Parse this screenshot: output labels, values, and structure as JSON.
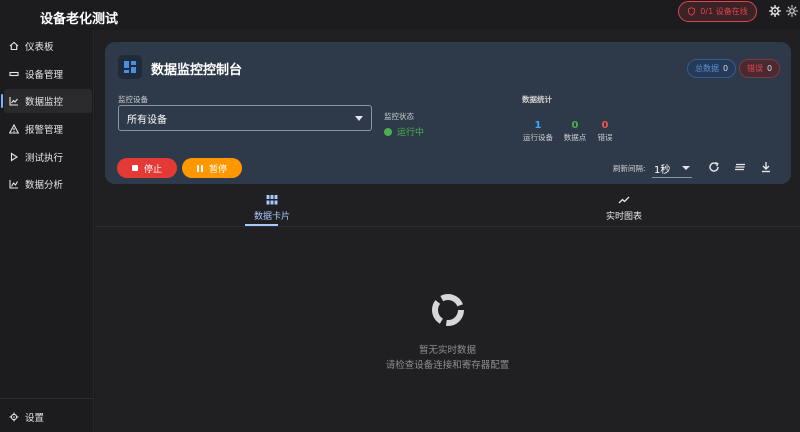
{
  "app": {
    "title": "设备老化测试"
  },
  "header": {
    "online_badge": "0/1 设备在线"
  },
  "sidebar": {
    "items": [
      {
        "label": "仪表板",
        "icon": "home-icon"
      },
      {
        "label": "设备管理",
        "icon": "device-icon"
      },
      {
        "label": "数据监控",
        "icon": "chart-icon"
      },
      {
        "label": "报警管理",
        "icon": "warning-icon"
      },
      {
        "label": "测试执行",
        "icon": "play-icon"
      },
      {
        "label": "数据分析",
        "icon": "analytics-icon"
      }
    ],
    "settings_label": "设置"
  },
  "panel": {
    "title": "数据监控控制台",
    "total_chip": {
      "label": "总数据",
      "value": "0"
    },
    "error_chip": {
      "label": "错误",
      "value": "0"
    },
    "device_select": {
      "label": "监控设备",
      "value": "所有设备"
    },
    "status": {
      "label": "监控状态",
      "value": "运行中"
    },
    "stats": {
      "title": "数据统计",
      "running": {
        "value": "1",
        "label": "运行设备",
        "color": "#42a5f5"
      },
      "points": {
        "value": "0",
        "label": "数据点",
        "color": "#4caf50"
      },
      "errors": {
        "value": "0",
        "label": "错误",
        "color": "#ef5350"
      }
    },
    "buttons": {
      "stop": "停止",
      "pause": "暂停"
    },
    "refresh": {
      "label": "刷新间隔:",
      "value": "1秒"
    }
  },
  "tabs": [
    {
      "label": "数据卡片",
      "icon": "grid-icon"
    },
    {
      "label": "实时图表",
      "icon": "trend-icon"
    }
  ],
  "empty": {
    "title": "暂无实时数据",
    "subtitle": "请检查设备连接和寄存器配置"
  },
  "colors": {
    "accent": "#a8c8ff",
    "stop": "#e53935",
    "pause": "#ff9800",
    "running": "#4caf50"
  }
}
